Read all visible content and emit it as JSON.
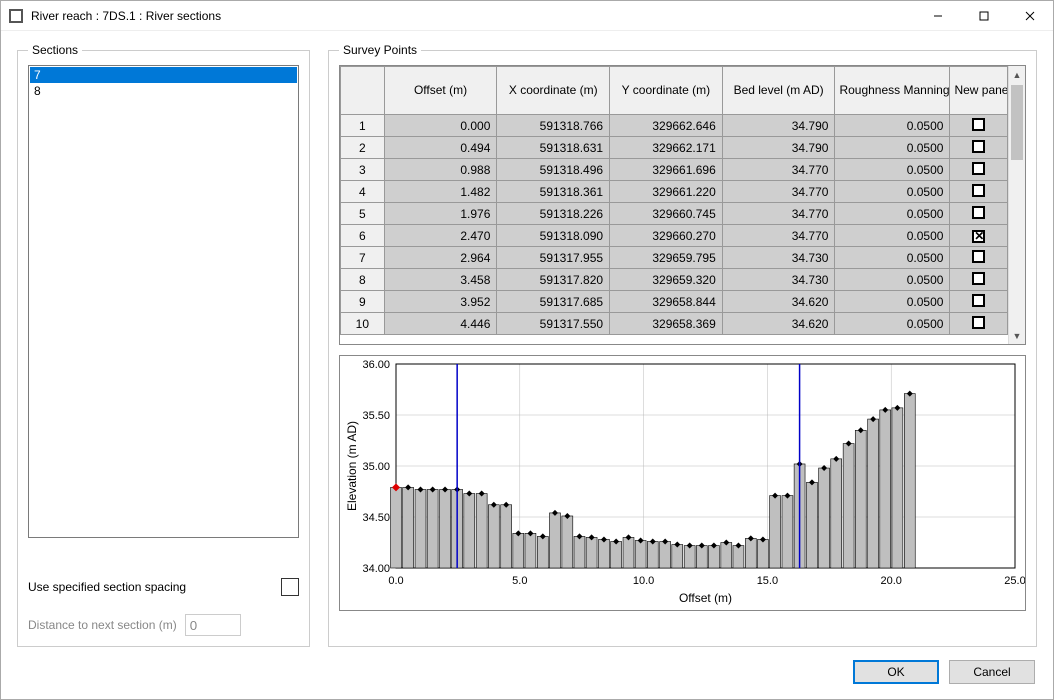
{
  "window": {
    "title": "River reach : 7DS.1 : River sections"
  },
  "left": {
    "legend": "Sections",
    "items": [
      "7",
      "8"
    ],
    "selected_index": 0,
    "spacing_label": "Use specified section spacing",
    "spacing_checked": false,
    "distance_label": "Distance to next section (m)",
    "distance_value": "0"
  },
  "survey": {
    "legend": "Survey Points",
    "headers": {
      "rownum": "",
      "offset": "Offset (m)",
      "x": "X coordinate (m)",
      "y": "Y coordinate (m)",
      "bed": "Bed level (m AD)",
      "roughness": "Roughness Manning's n",
      "panel": "New panel"
    },
    "rows": [
      {
        "n": "1",
        "offset": "0.000",
        "x": "591318.766",
        "y": "329662.646",
        "bed": "34.790",
        "rough": "0.0500",
        "panel": false
      },
      {
        "n": "2",
        "offset": "0.494",
        "x": "591318.631",
        "y": "329662.171",
        "bed": "34.790",
        "rough": "0.0500",
        "panel": false
      },
      {
        "n": "3",
        "offset": "0.988",
        "x": "591318.496",
        "y": "329661.696",
        "bed": "34.770",
        "rough": "0.0500",
        "panel": false
      },
      {
        "n": "4",
        "offset": "1.482",
        "x": "591318.361",
        "y": "329661.220",
        "bed": "34.770",
        "rough": "0.0500",
        "panel": false
      },
      {
        "n": "5",
        "offset": "1.976",
        "x": "591318.226",
        "y": "329660.745",
        "bed": "34.770",
        "rough": "0.0500",
        "panel": false
      },
      {
        "n": "6",
        "offset": "2.470",
        "x": "591318.090",
        "y": "329660.270",
        "bed": "34.770",
        "rough": "0.0500",
        "panel": true
      },
      {
        "n": "7",
        "offset": "2.964",
        "x": "591317.955",
        "y": "329659.795",
        "bed": "34.730",
        "rough": "0.0500",
        "panel": false
      },
      {
        "n": "8",
        "offset": "3.458",
        "x": "591317.820",
        "y": "329659.320",
        "bed": "34.730",
        "rough": "0.0500",
        "panel": false
      },
      {
        "n": "9",
        "offset": "3.952",
        "x": "591317.685",
        "y": "329658.844",
        "bed": "34.620",
        "rough": "0.0500",
        "panel": false
      },
      {
        "n": "10",
        "offset": "4.446",
        "x": "591317.550",
        "y": "329658.369",
        "bed": "34.620",
        "rough": "0.0500",
        "panel": false
      }
    ]
  },
  "chart_data": {
    "type": "bar",
    "title": "",
    "xlabel": "Offset (m)",
    "ylabel": "Elevation (m AD)",
    "xlim": [
      0,
      25
    ],
    "ylim": [
      34.0,
      36.0
    ],
    "xticks": [
      0,
      5,
      10,
      15,
      20,
      25
    ],
    "yticks": [
      34.0,
      34.5,
      35.0,
      35.5,
      36.0
    ],
    "x": [
      0.0,
      0.49,
      0.99,
      1.48,
      1.98,
      2.47,
      2.96,
      3.46,
      3.95,
      4.45,
      4.94,
      5.43,
      5.93,
      6.42,
      6.92,
      7.41,
      7.9,
      8.4,
      8.89,
      9.39,
      9.88,
      10.37,
      10.87,
      11.36,
      11.86,
      12.35,
      12.84,
      13.34,
      13.83,
      14.33,
      14.82,
      15.31,
      15.81,
      16.3,
      16.8,
      17.29,
      17.78,
      18.28,
      18.77,
      19.27,
      19.76,
      20.25,
      20.75
    ],
    "values": [
      34.79,
      34.79,
      34.77,
      34.77,
      34.77,
      34.77,
      34.73,
      34.73,
      34.62,
      34.62,
      34.34,
      34.34,
      34.31,
      34.54,
      34.51,
      34.31,
      34.3,
      34.28,
      34.26,
      34.3,
      34.27,
      34.26,
      34.26,
      34.23,
      34.22,
      34.22,
      34.22,
      34.25,
      34.22,
      34.29,
      34.28,
      34.71,
      34.71,
      35.02,
      34.84,
      34.98,
      35.07,
      35.22,
      35.35,
      35.46,
      35.55,
      35.57,
      35.71
    ],
    "panel_lines_x": [
      2.47,
      16.3
    ]
  },
  "footer": {
    "ok": "OK",
    "cancel": "Cancel"
  }
}
